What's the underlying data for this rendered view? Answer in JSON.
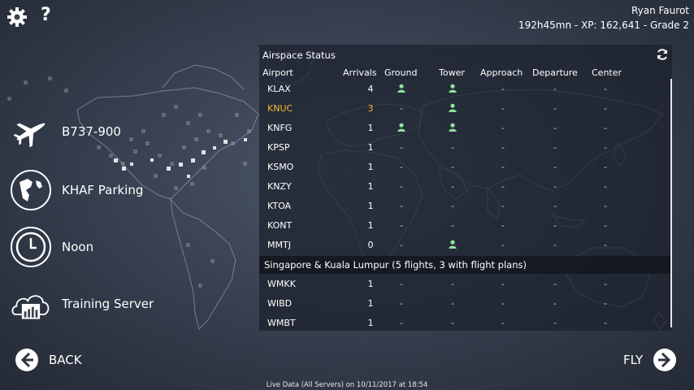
{
  "user": {
    "name": "Ryan Faurot",
    "stats": "192h45mn - XP: 162,641 - Grade 2"
  },
  "icons": {
    "settings": "gear-icon",
    "help": "question-mark-icon",
    "refresh": "refresh-icon",
    "back": "arrow-left-icon",
    "fly": "arrow-right-icon"
  },
  "sidebar": {
    "items": [
      {
        "label": "B737-900",
        "icon": "airplane-icon"
      },
      {
        "label": "KHAF Parking",
        "icon": "globe-icon"
      },
      {
        "label": "Noon",
        "icon": "clock-icon"
      },
      {
        "label": "Training Server",
        "icon": "server-chart-icon"
      }
    ]
  },
  "panel": {
    "title": "Airspace Status",
    "columns": [
      "Airport",
      "Arrivals",
      "Ground",
      "Tower",
      "Approach",
      "Departure",
      "Center"
    ],
    "rows": [
      {
        "airport": "KLAX",
        "arrivals": "4",
        "ground": "pin",
        "tower": "pin",
        "approach": "-",
        "departure": "-",
        "center": "-"
      },
      {
        "airport": "KNUC",
        "arrivals": "3",
        "ground": "-",
        "tower": "pin",
        "approach": "-",
        "departure": "-",
        "center": "-",
        "highlight": true
      },
      {
        "airport": "KNFG",
        "arrivals": "1",
        "ground": "pin",
        "tower": "pin",
        "approach": "-",
        "departure": "-",
        "center": "-"
      },
      {
        "airport": "KPSP",
        "arrivals": "1",
        "ground": "-",
        "tower": "-",
        "approach": "-",
        "departure": "-",
        "center": "-"
      },
      {
        "airport": "KSMO",
        "arrivals": "1",
        "ground": "-",
        "tower": "-",
        "approach": "-",
        "departure": "-",
        "center": "-"
      },
      {
        "airport": "KNZY",
        "arrivals": "1",
        "ground": "-",
        "tower": "-",
        "approach": "-",
        "departure": "-",
        "center": "-"
      },
      {
        "airport": "KTOA",
        "arrivals": "1",
        "ground": "-",
        "tower": "-",
        "approach": "-",
        "departure": "-",
        "center": "-"
      },
      {
        "airport": "KONT",
        "arrivals": "1",
        "ground": "-",
        "tower": "-",
        "approach": "-",
        "departure": "-",
        "center": "-"
      },
      {
        "airport": "MMTJ",
        "arrivals": "0",
        "ground": "-",
        "tower": "pin",
        "approach": "-",
        "departure": "-",
        "center": "-"
      }
    ],
    "group_header": "Singapore & Kuala Lumpur (5 flights, 3 with flight plans)",
    "rows2": [
      {
        "airport": "WMKK",
        "arrivals": "1",
        "ground": "-",
        "tower": "-",
        "approach": "-",
        "departure": "-",
        "center": "-"
      },
      {
        "airport": "WIBD",
        "arrivals": "1",
        "ground": "-",
        "tower": "-",
        "approach": "-",
        "departure": "-",
        "center": "-"
      },
      {
        "airport": "WMBT",
        "arrivals": "1",
        "ground": "-",
        "tower": "-",
        "approach": "-",
        "departure": "-",
        "center": "-"
      }
    ]
  },
  "nav": {
    "back": "BACK",
    "fly": "FLY"
  },
  "footer": "Live Data (All Servers) on 10/11/2017 at 18:54",
  "colors": {
    "highlight": "#f0b83a",
    "controller_pin": "#8ee39a"
  }
}
